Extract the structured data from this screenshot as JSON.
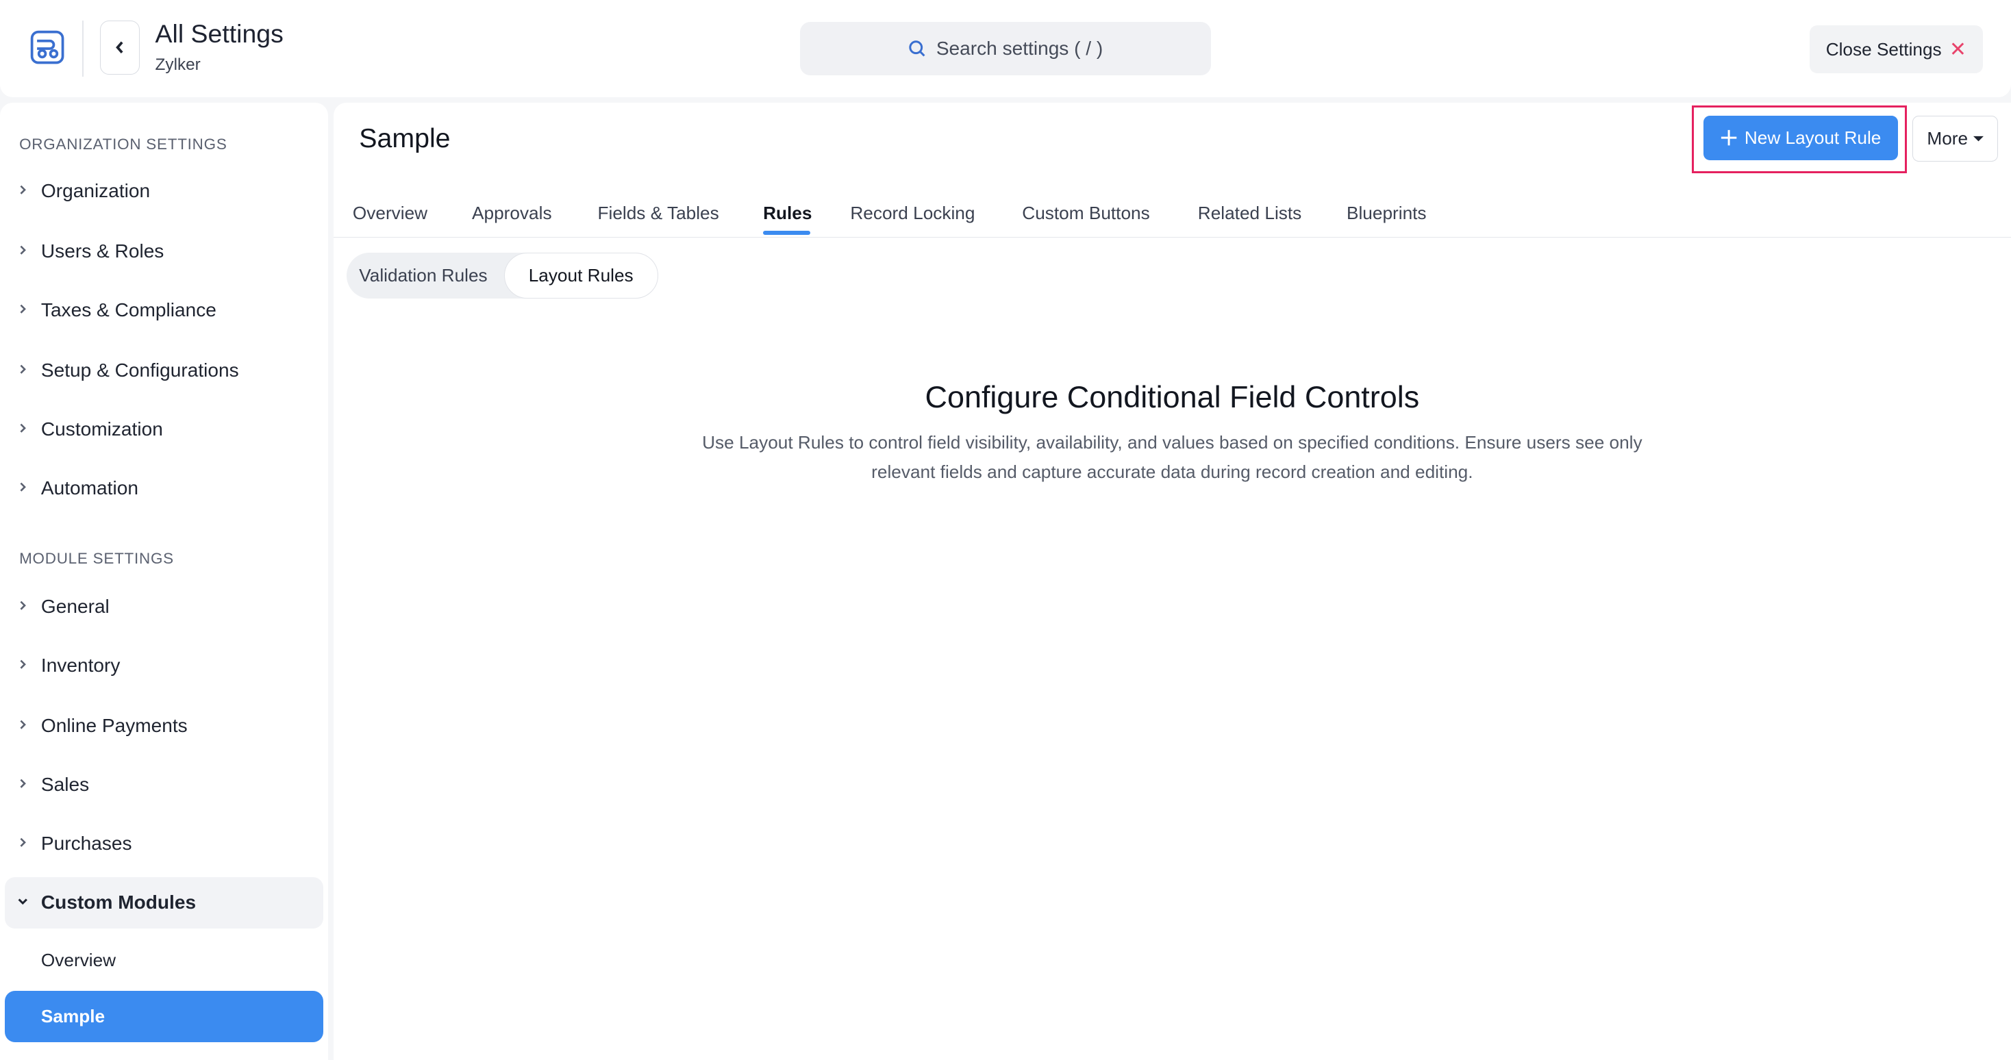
{
  "header": {
    "title": "All Settings",
    "subtitle": "Zylker",
    "search_placeholder": "Search settings ( / )",
    "close_label": "Close Settings",
    "icons": {
      "logo": "app-logo-icon",
      "back": "chevron-left-icon",
      "search": "search-icon",
      "close": "close-x-icon"
    }
  },
  "sidebar": {
    "org_section_title": "ORGANIZATION SETTINGS",
    "org_items": [
      "Organization",
      "Users & Roles",
      "Taxes & Compliance",
      "Setup & Configurations",
      "Customization",
      "Automation"
    ],
    "module_section_title": "MODULE SETTINGS",
    "module_items": [
      "General",
      "Inventory",
      "Online Payments",
      "Sales",
      "Purchases"
    ],
    "custom_modules": {
      "label": "Custom Modules",
      "children": [
        "Overview",
        "Sample"
      ],
      "active_child": "Sample"
    }
  },
  "main": {
    "title": "Sample",
    "new_rule_label": "New Layout Rule",
    "more_label": "More",
    "tabs": [
      "Overview",
      "Approvals",
      "Fields & Tables",
      "Rules",
      "Record Locking",
      "Custom Buttons",
      "Related Lists",
      "Blueprints"
    ],
    "active_tab": "Rules",
    "segments": [
      "Validation Rules",
      "Layout Rules"
    ],
    "active_segment": "Layout Rules",
    "empty_state": {
      "title": "Configure Conditional Field Controls",
      "description": "Use Layout Rules to control field visibility, availability, and values based on specified conditions. Ensure users see only relevant fields and capture accurate data during record creation and editing."
    }
  },
  "colors": {
    "accent": "#3b8bf0",
    "highlight": "#e5215f",
    "close_x": "#e8436b"
  }
}
